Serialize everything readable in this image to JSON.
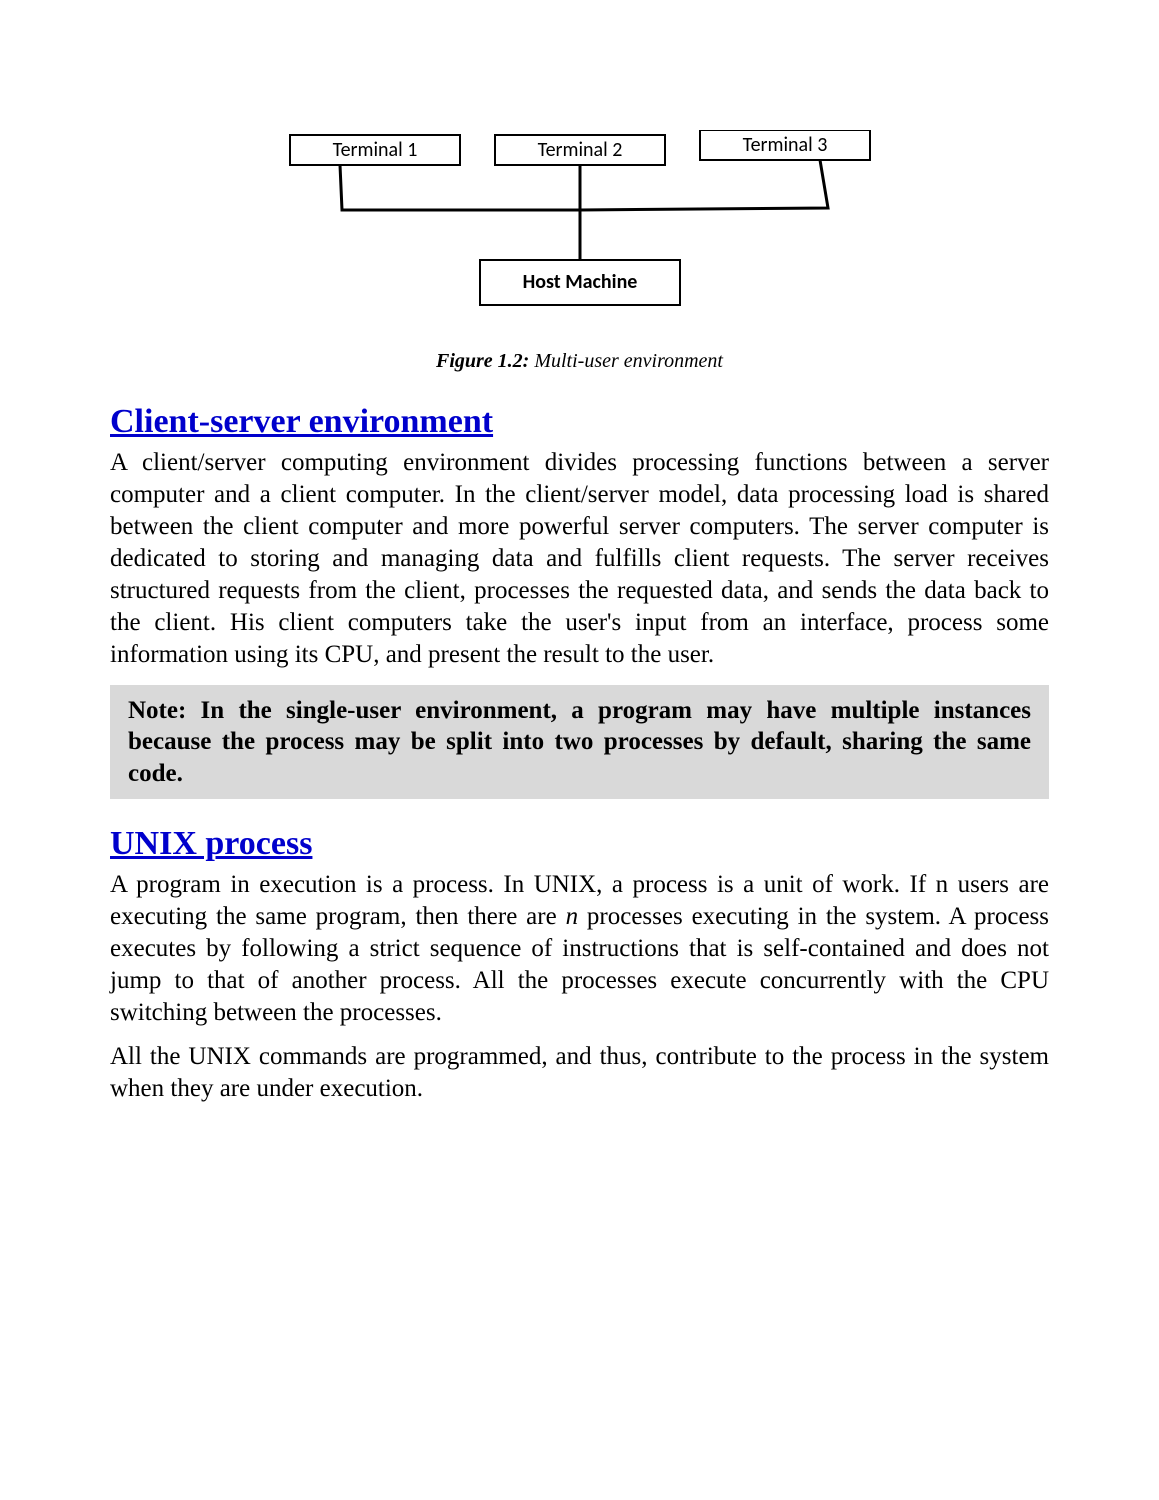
{
  "diagram": {
    "boxes": [
      "Terminal 1",
      "Terminal 2",
      "Terminal 3"
    ],
    "host": "Host Machine"
  },
  "caption": {
    "label": "Figure 1.2:",
    "title": "Multi-user environment"
  },
  "sections": {
    "clientServer": {
      "heading": "Client-server environment",
      "para": "A client/server computing environment divides processing functions between a server computer and a client computer. In the client/server model, data processing load is shared between the client computer and more powerful server computers. The server computer is dedicated to storing and managing data and fulfills client requests. The server receives structured requests from the client, processes the requested data, and sends the data back to the client. His client computers take the user's input from an interface, process some information using its CPU, and present the result to the user."
    },
    "note": "Note: In the single-user environment, a program may have multiple instances because the process may be split into two processes by default, sharing the same code.",
    "unixProcess": {
      "heading": "UNIX process",
      "para1_a": "A program in execution is a process. In UNIX, a process is a unit of work. If n users are executing the same program, then there are ",
      "para1_n": "n",
      "para1_b": " processes executing in the system. A process executes by following a strict sequence of instructions that is self-contained and does not jump to that of another process. All the processes execute concurrently with the CPU switching between the processes.",
      "para2": "All the UNIX commands are programmed, and thus, contribute to the process in the system when they are under execution."
    }
  }
}
